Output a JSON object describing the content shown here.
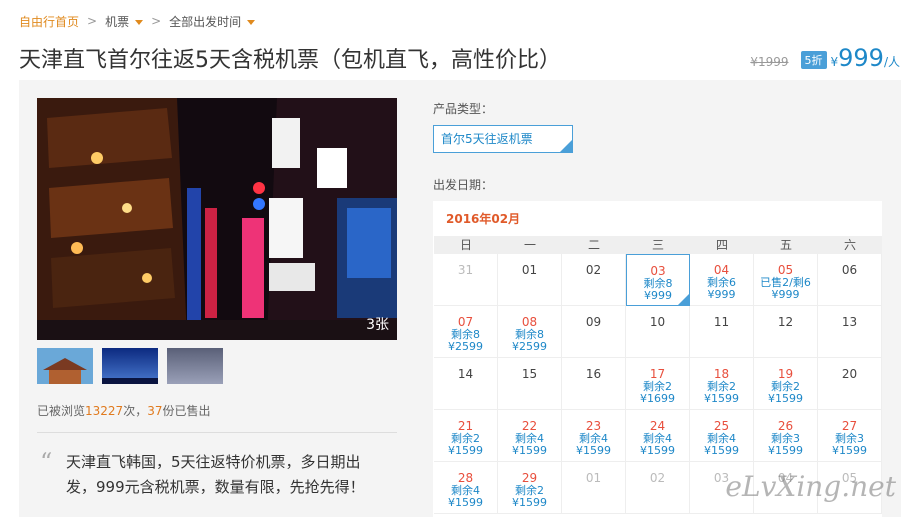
{
  "breadcrumb": {
    "home": "自由行首页",
    "sep": ">",
    "c2": "机票",
    "c3": "全部出发时间"
  },
  "product": {
    "title": "天津直飞首尔往返5天含税机票（包机直飞，高性价比）",
    "old_price": "¥1999",
    "discount": "5折",
    "currency": "¥",
    "price": "999",
    "unit": "/人"
  },
  "gallery": {
    "photo_count": "3张"
  },
  "stats": {
    "pre": "已被浏览",
    "views": "13227",
    "mid": "次，",
    "sold": "37",
    "post": "份已售出"
  },
  "description": "天津直飞韩国，5天往返特价机票，多日期出发，999元含税机票，数量有限，先抢先得！",
  "options": {
    "type_label": "产品类型：",
    "type_value": "首尔5天往返机票",
    "date_label": "出发日期："
  },
  "calendar": {
    "month": "2016年02月",
    "weekdays": [
      "日",
      "一",
      "二",
      "三",
      "四",
      "五",
      "六"
    ],
    "cells": [
      {
        "d": "31",
        "s1": "",
        "s2": "",
        "style": "grey"
      },
      {
        "d": "01",
        "s1": "",
        "s2": "",
        "style": ""
      },
      {
        "d": "02",
        "s1": "",
        "s2": "",
        "style": ""
      },
      {
        "d": "03",
        "s1": "剩余8",
        "s2": "¥999",
        "style": "red sel"
      },
      {
        "d": "04",
        "s1": "剩余6",
        "s2": "¥999",
        "style": "red"
      },
      {
        "d": "05",
        "s1": "已售2/剩6",
        "s2": "¥999",
        "style": "red"
      },
      {
        "d": "06",
        "s1": "",
        "s2": "",
        "style": ""
      },
      {
        "d": "07",
        "s1": "剩余8",
        "s2": "¥2599",
        "style": "red"
      },
      {
        "d": "08",
        "s1": "剩余8",
        "s2": "¥2599",
        "style": "red"
      },
      {
        "d": "09",
        "s1": "",
        "s2": "",
        "style": ""
      },
      {
        "d": "10",
        "s1": "",
        "s2": "",
        "style": ""
      },
      {
        "d": "11",
        "s1": "",
        "s2": "",
        "style": ""
      },
      {
        "d": "12",
        "s1": "",
        "s2": "",
        "style": ""
      },
      {
        "d": "13",
        "s1": "",
        "s2": "",
        "style": ""
      },
      {
        "d": "14",
        "s1": "",
        "s2": "",
        "style": ""
      },
      {
        "d": "15",
        "s1": "",
        "s2": "",
        "style": ""
      },
      {
        "d": "16",
        "s1": "",
        "s2": "",
        "style": ""
      },
      {
        "d": "17",
        "s1": "剩余2",
        "s2": "¥1699",
        "style": "red"
      },
      {
        "d": "18",
        "s1": "剩余2",
        "s2": "¥1599",
        "style": "red"
      },
      {
        "d": "19",
        "s1": "剩余2",
        "s2": "¥1599",
        "style": "red"
      },
      {
        "d": "20",
        "s1": "",
        "s2": "",
        "style": ""
      },
      {
        "d": "21",
        "s1": "剩余2",
        "s2": "¥1599",
        "style": "red"
      },
      {
        "d": "22",
        "s1": "剩余4",
        "s2": "¥1599",
        "style": "red"
      },
      {
        "d": "23",
        "s1": "剩余4",
        "s2": "¥1599",
        "style": "red"
      },
      {
        "d": "24",
        "s1": "剩余4",
        "s2": "¥1599",
        "style": "red"
      },
      {
        "d": "25",
        "s1": "剩余4",
        "s2": "¥1599",
        "style": "red"
      },
      {
        "d": "26",
        "s1": "剩余3",
        "s2": "¥1599",
        "style": "red"
      },
      {
        "d": "27",
        "s1": "剩余3",
        "s2": "¥1599",
        "style": "red"
      },
      {
        "d": "28",
        "s1": "剩余4",
        "s2": "¥1599",
        "style": "red"
      },
      {
        "d": "29",
        "s1": "剩余2",
        "s2": "¥1599",
        "style": "red"
      },
      {
        "d": "01",
        "s1": "",
        "s2": "",
        "style": "grey"
      },
      {
        "d": "02",
        "s1": "",
        "s2": "",
        "style": "grey"
      },
      {
        "d": "03",
        "s1": "",
        "s2": "",
        "style": "grey"
      },
      {
        "d": "04",
        "s1": "",
        "s2": "",
        "style": "grey"
      },
      {
        "d": "05",
        "s1": "",
        "s2": "",
        "style": "grey"
      }
    ]
  },
  "watermark": "eLvXing.net",
  "colors": {
    "accent": "#1e88c8",
    "brand": "#e08a1e",
    "highlight": "#e84f3d"
  }
}
